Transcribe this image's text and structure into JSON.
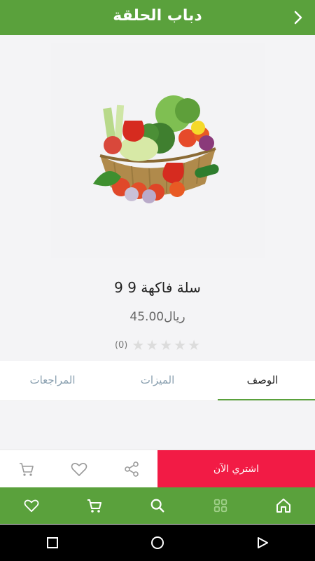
{
  "header": {
    "title": "دباب الحلقة",
    "back_icon": "chevron-right-icon"
  },
  "product": {
    "image_alt": "vegetable basket",
    "title": "سلة فاكهة 9 9",
    "price": "ريال45.00",
    "rating": {
      "stars_filled": 0,
      "stars_total": 5,
      "count": "(0)"
    }
  },
  "tabs": [
    {
      "label": "المراجعات",
      "active": false
    },
    {
      "label": "الميزات",
      "active": false
    },
    {
      "label": "الوصف",
      "active": true
    }
  ],
  "actions": {
    "buy_label": "اشتري الآن",
    "icons": [
      "share-icon",
      "heart-icon",
      "cart-icon"
    ]
  },
  "bottom_nav": [
    "heart-icon",
    "cart-icon",
    "search-icon",
    "grid-icon",
    "home-icon"
  ],
  "system_nav": [
    "square-icon",
    "circle-icon",
    "triangle-icon"
  ],
  "colors": {
    "brand_green": "#5aa13c",
    "buy_red": "#f21b45",
    "star_grey": "#dcdcdc"
  }
}
